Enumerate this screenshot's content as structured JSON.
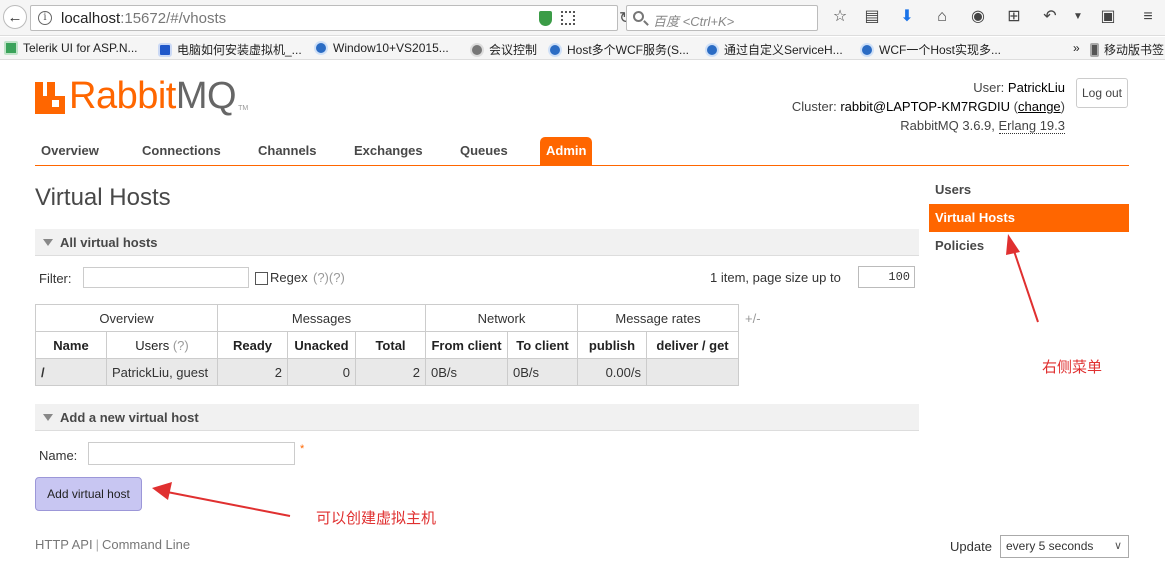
{
  "browser": {
    "url_host": "localhost",
    "url_rest": ":15672/#/vhosts",
    "search_placeholder": "百度 <Ctrl+K>",
    "bookmarks": [
      {
        "label": "Telerik UI for ASP.N...",
        "icon": "telerik-icon"
      },
      {
        "label": "电脑如何安装虚拟机_...",
        "icon": "baidu-paw-icon"
      },
      {
        "label": "Window10+VS2015...",
        "icon": "site-icon"
      },
      {
        "label": "会议控制",
        "icon": "globe-icon"
      },
      {
        "label": "Host多个WCF服务(S...",
        "icon": "site-icon"
      },
      {
        "label": "通过自定义ServiceH...",
        "icon": "site-icon"
      },
      {
        "label": "WCF一个Host实现多...",
        "icon": "site-icon"
      },
      {
        "label": "移动版书签",
        "icon": "mobile-icon"
      }
    ],
    "overflow": "»"
  },
  "header": {
    "logo_rabbit": "Rabbit",
    "logo_mq": "MQ",
    "logo_tm": "TM",
    "user_label": "User:",
    "user": "PatrickLiu",
    "cluster_label": "Cluster:",
    "cluster": "rabbit@LAPTOP-KM7RGDIU",
    "change_link": "change",
    "version": "RabbitMQ 3.6.9,",
    "erlang": "Erlang 19.3",
    "logout": "Log out"
  },
  "tabs": [
    {
      "label": "Overview",
      "active": false
    },
    {
      "label": "Connections",
      "active": false
    },
    {
      "label": "Channels",
      "active": false
    },
    {
      "label": "Exchanges",
      "active": false
    },
    {
      "label": "Queues",
      "active": false
    },
    {
      "label": "Admin",
      "active": true
    }
  ],
  "page_title": "Virtual Hosts",
  "all_vhosts": {
    "section_title": "All virtual hosts",
    "filter_label": "Filter:",
    "filter_value": "",
    "regex_label": "Regex",
    "regex_help": "(?)(?)",
    "page_info": "1 item, page size up to",
    "page_size": "100",
    "group_headers": [
      "Overview",
      "Messages",
      "Network",
      "Message rates"
    ],
    "plus_minus": "+/-",
    "columns": [
      "Name",
      "Users",
      "(?)",
      "Ready",
      "Unacked",
      "Total",
      "From client",
      "To client",
      "publish",
      "deliver / get"
    ],
    "rows": [
      {
        "name": "/",
        "users": "PatrickLiu, guest",
        "ready": "2",
        "unacked": "0",
        "total": "2",
        "from_client": "0B/s",
        "to_client": "0B/s",
        "publish": "0.00/s",
        "deliver_get": ""
      }
    ]
  },
  "add_vhost": {
    "section_title": "Add a new virtual host",
    "name_label": "Name:",
    "name_value": "",
    "required_mark": "*",
    "button": "Add virtual host"
  },
  "footer": {
    "http_api": "HTTP API",
    "sep": "|",
    "command_line": "Command Line",
    "update_label": "Update",
    "update_value": "every 5 seconds"
  },
  "sidebar": {
    "items": [
      {
        "label": "Users",
        "active": false
      },
      {
        "label": "Virtual Hosts",
        "active": true
      },
      {
        "label": "Policies",
        "active": false
      }
    ]
  },
  "annotations": {
    "right_menu": "右侧菜单",
    "create_vhost": "可以创建虚拟主机",
    "color": "#e03030"
  },
  "colors": {
    "accent": "#ff6600",
    "button_bg": "#c8c6f2"
  }
}
